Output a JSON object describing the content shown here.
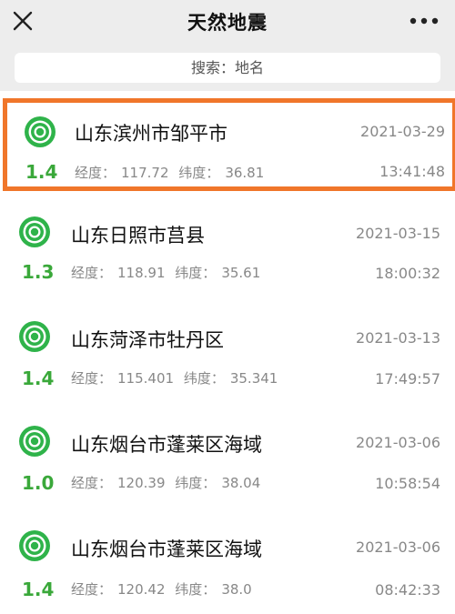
{
  "header": {
    "title": "天然地震",
    "close_icon": "close-icon",
    "more_icon": "more-dots-icon"
  },
  "search": {
    "placeholder": "搜索：地名"
  },
  "colors": {
    "magnitude": "#3aa83a",
    "highlight_border": "#f0762a",
    "header_bg": "#ededed"
  },
  "quakes": [
    {
      "place": "山东滨州市邹平市",
      "date": "2021-03-29",
      "magnitude": "1.4",
      "lon_label": "经度：",
      "lon": "117.72",
      "lat_label": "纬度：",
      "lat": "36.81",
      "time": "13:41:48"
    },
    {
      "place": "山东日照市莒县",
      "date": "2021-03-15",
      "magnitude": "1.3",
      "lon_label": "经度：",
      "lon": "118.91",
      "lat_label": "纬度：",
      "lat": "35.61",
      "time": "18:00:32"
    },
    {
      "place": "山东菏泽市牡丹区",
      "date": "2021-03-13",
      "magnitude": "1.4",
      "lon_label": "经度：",
      "lon": "115.401",
      "lat_label": "纬度：",
      "lat": "35.341",
      "time": "17:49:57"
    },
    {
      "place": "山东烟台市蓬莱区海域",
      "date": "2021-03-06",
      "magnitude": "1.0",
      "lon_label": "经度：",
      "lon": "120.39",
      "lat_label": "纬度：",
      "lat": "38.04",
      "time": "10:58:54"
    },
    {
      "place": "山东烟台市蓬莱区海域",
      "date": "2021-03-06",
      "magnitude": "1.4",
      "lon_label": "经度：",
      "lon": "120.42",
      "lat_label": "纬度：",
      "lat": "38.0",
      "time": "08:42:33"
    }
  ]
}
